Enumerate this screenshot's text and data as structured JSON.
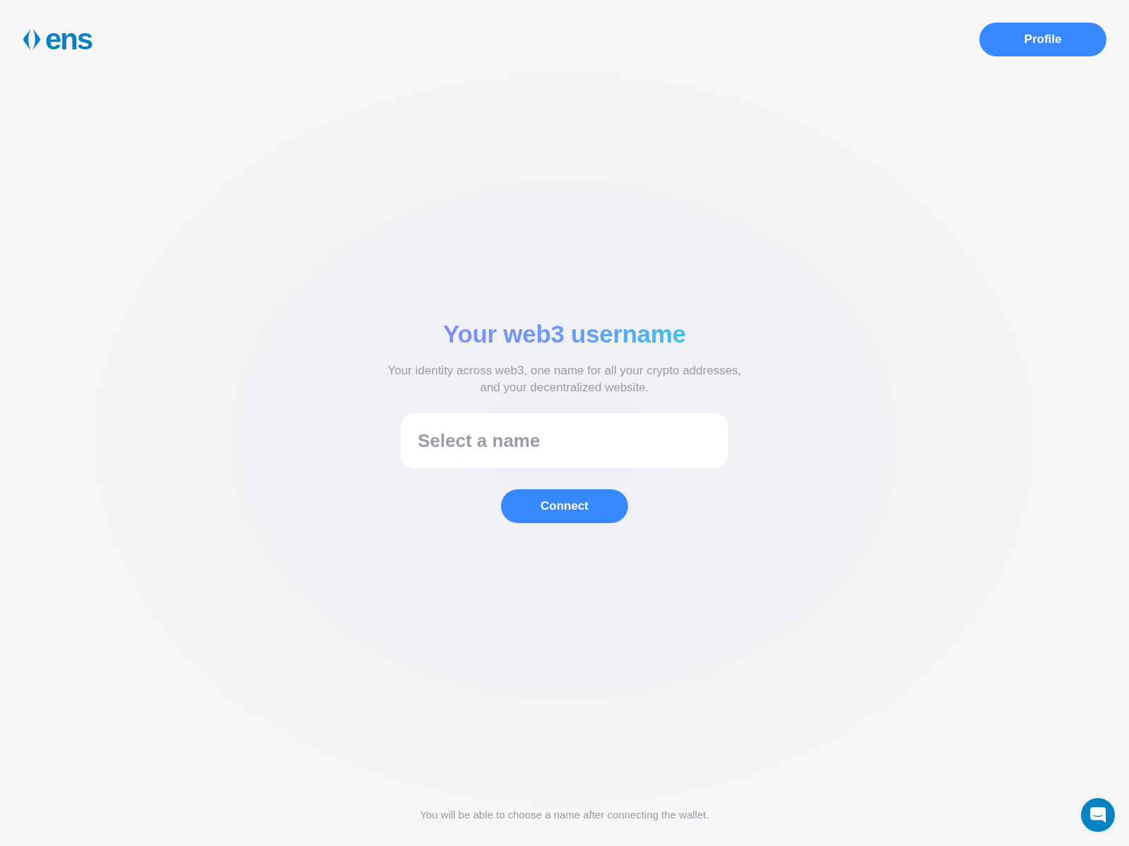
{
  "header": {
    "logo": {
      "text": "ens"
    },
    "profile_button": "Profile"
  },
  "hero": {
    "title": "Your web3 username",
    "subtitle": "Your identity across web3, one name for all your crypto addresses, and your decentralized website.",
    "search": {
      "placeholder": "Select a name"
    },
    "connect_button": "Connect"
  },
  "footer": {
    "note": "You will be able to choose a name after connecting the wallet."
  }
}
